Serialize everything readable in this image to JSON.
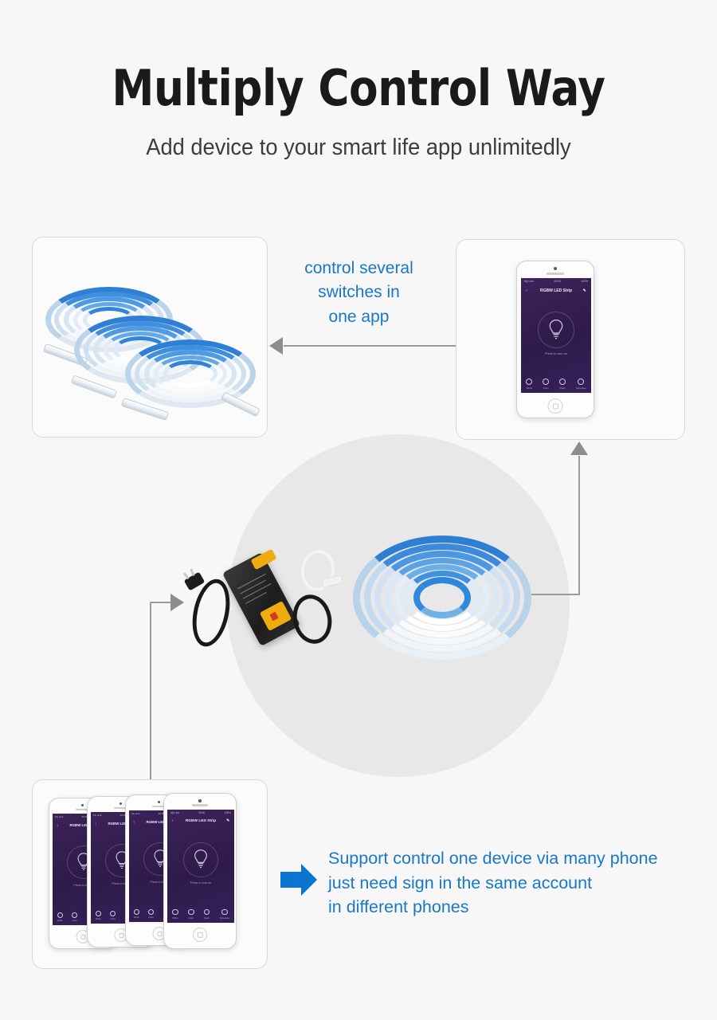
{
  "page": {
    "background_color": "#f7f7f7",
    "accent_blue": "#1878c8",
    "line_gray": "#9a9a9a"
  },
  "header": {
    "title": "Multiply Control Way",
    "subtitle": "Add device to your smart life app unlimitedly"
  },
  "captions": {
    "top": [
      "control several",
      "switches in",
      "one app"
    ],
    "bottom": [
      "Support control one device via many phone",
      "just need sign in the same account",
      "in different phones"
    ]
  },
  "cards": {
    "led_strips": {
      "name": "led-strip-reels",
      "item_count": 3
    },
    "single_phone": {
      "name": "single-phone-card"
    },
    "multi_phones": {
      "name": "multiple-phones-card",
      "phone_count": 4
    }
  },
  "app_screen": {
    "status_left": "My Link",
    "status_center": "09:00",
    "status_right": "100%",
    "back_icon": "chevron-left-icon",
    "title": "RGBW LED Strip",
    "edit_icon": "pencil-icon",
    "bulb_icon": "bulb-icon",
    "press_label": "Press to turn on",
    "tabs": [
      {
        "label": "White",
        "icon": "white-circle-icon"
      },
      {
        "label": "Color",
        "icon": "color-circle-icon"
      },
      {
        "label": "Flash",
        "icon": "flash-circle-icon"
      },
      {
        "label": "Schedule",
        "icon": "schedule-circle-icon"
      }
    ],
    "home_icon": "home-button-icon"
  },
  "product": {
    "power_adapter": "led-power-adapter",
    "led_coil": "led-strip-coil",
    "power_plug": "power-plug-icon",
    "connector": "strip-connector"
  },
  "arrows": {
    "phone_to_strips": "arrow-left-icon",
    "product_to_phone": "arrow-up-icon",
    "phones_to_product": "arrow-right-icon",
    "bottom_callout": "big-blue-arrow-right-icon"
  }
}
